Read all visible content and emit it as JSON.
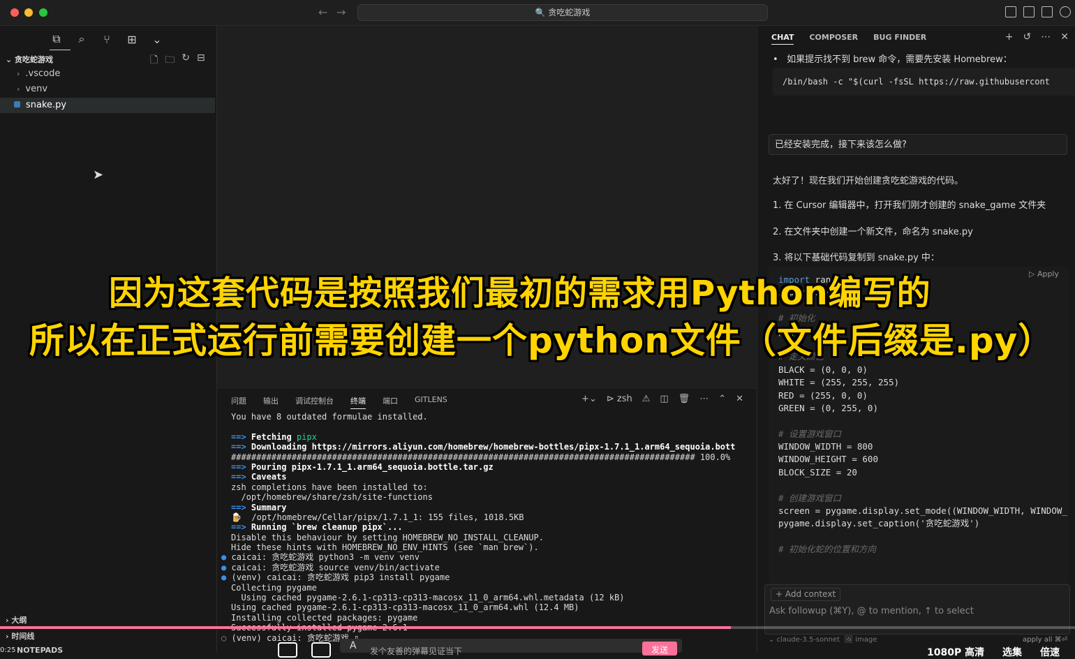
{
  "titlebar": {
    "search_title": "🔍 贪吃蛇游戏"
  },
  "sidebar": {
    "folder": "贪吃蛇游戏",
    "items": [
      ".vscode",
      "venv",
      "snake.py"
    ],
    "sections": [
      "大纲",
      "时间线",
      "NOTEPADS"
    ]
  },
  "panel": {
    "tabs": [
      "问题",
      "输出",
      "调试控制台",
      "终端",
      "端口",
      "GITLENS"
    ],
    "shell": "zsh",
    "terminal": [
      {
        "t": "plain",
        "text": "You have 8 outdated formulae installed."
      },
      {
        "t": "plain",
        "text": ""
      },
      {
        "t": "fetch",
        "prefix": "==>",
        "label": "Fetching",
        "rest": " pipx"
      },
      {
        "t": "arrow",
        "prefix": "==>",
        "text": "Downloading https://mirrors.aliyun.com/homebrew/homebrew-bottles/pipx-1.7.1_1.arm64_sequoia.bott"
      },
      {
        "t": "plain",
        "text": "############################################################################################ 100.0%"
      },
      {
        "t": "arrow",
        "prefix": "==>",
        "text": "Pouring pipx-1.7.1_1.arm64_sequoia.bottle.tar.gz"
      },
      {
        "t": "arrow",
        "prefix": "==>",
        "text": "Caveats"
      },
      {
        "t": "plain",
        "text": "zsh completions have been installed to:"
      },
      {
        "t": "plain",
        "text": "  /opt/homebrew/share/zsh/site-functions"
      },
      {
        "t": "arrow",
        "prefix": "==>",
        "text": "Summary"
      },
      {
        "t": "plain",
        "text": "🍺  /opt/homebrew/Cellar/pipx/1.7.1_1: 155 files, 1018.5KB"
      },
      {
        "t": "arrow",
        "prefix": "==>",
        "text": "Running `brew cleanup pipx`..."
      },
      {
        "t": "plain",
        "text": "Disable this behaviour by setting HOMEBREW_NO_INSTALL_CLEANUP."
      },
      {
        "t": "plain",
        "text": "Hide these hints with HOMEBREW_NO_ENV_HINTS (see `man brew`)."
      },
      {
        "t": "prompt",
        "text": "caicai: 贪吃蛇游戏 python3 -m venv venv"
      },
      {
        "t": "prompt",
        "text": "caicai: 贪吃蛇游戏 source venv/bin/activate"
      },
      {
        "t": "prompt",
        "text": "(venv) caicai: 贪吃蛇游戏 pip3 install pygame"
      },
      {
        "t": "plain",
        "text": "Collecting pygame"
      },
      {
        "t": "plain",
        "text": "  Using cached pygame-2.6.1-cp313-cp313-macosx_11_0_arm64.whl.metadata (12 kB)"
      },
      {
        "t": "plain",
        "text": "Using cached pygame-2.6.1-cp313-cp313-macosx_11_0_arm64.whl (12.4 MB)"
      },
      {
        "t": "plain",
        "text": "Installing collected packages: pygame"
      },
      {
        "t": "plain",
        "text": "Successfully installed pygame-2.6.1"
      },
      {
        "t": "prompt2",
        "text": "(venv) caicai: 贪吃蛇游戏 ▯"
      }
    ]
  },
  "chat": {
    "tabs": [
      "CHAT",
      "COMPOSER",
      "BUG FINDER"
    ],
    "bullet": "如果提示找不到 brew 命令，需要先安装 Homebrew：",
    "code1": "/bin/bash -c \"$(curl -fsSL https://raw.githubusercont",
    "user_msg": "已经安装完成，接下来该怎么做?",
    "reply_intro": "太好了！现在我们开始创建贪吃蛇游戏的代码。",
    "step1": "1. 在 Cursor 编辑器中，打开我们刚才创建的 snake_game 文件夹",
    "step2": "2. 在文件夹中创建一个新文件，命名为 snake.py",
    "step3": "3. 将以下基础代码复制到 snake.py 中：",
    "apply": "▷ Apply",
    "code_lines": [
      {
        "c": "kw",
        "text": "import random"
      },
      {
        "c": "plain",
        "text": "import sys"
      },
      {
        "c": "plain",
        "text": ""
      },
      {
        "c": "cm",
        "text": "# 初始化"
      },
      {
        "c": "fncall",
        "a": "pygame.",
        "b": "init",
        "d": "()"
      },
      {
        "c": "plain",
        "text": ""
      },
      {
        "c": "cm",
        "text": "# 定义颜色"
      },
      {
        "c": "plain",
        "text": "BLACK = (0, 0, 0)"
      },
      {
        "c": "plain",
        "text": "WHITE = (255, 255, 255)"
      },
      {
        "c": "plain",
        "text": "RED = (255, 0, 0)"
      },
      {
        "c": "plain",
        "text": "GREEN = (0, 255, 0)"
      },
      {
        "c": "plain",
        "text": ""
      },
      {
        "c": "cm",
        "text": "# 设置游戏窗口"
      },
      {
        "c": "plain",
        "text": "WINDOW_WIDTH = 800"
      },
      {
        "c": "plain",
        "text": "WINDOW_HEIGHT = 600"
      },
      {
        "c": "plain",
        "text": "BLOCK_SIZE = 20"
      },
      {
        "c": "plain",
        "text": ""
      },
      {
        "c": "cm",
        "text": "# 创建游戏窗口"
      },
      {
        "c": "plain",
        "text": "screen = pygame.display.set_mode((WINDOW_WIDTH, WINDOW_"
      },
      {
        "c": "plain",
        "text": "pygame.display.set_caption('贪吃蛇游戏')"
      },
      {
        "c": "plain",
        "text": ""
      },
      {
        "c": "cm",
        "text": "# 初始化蛇的位置和方向"
      }
    ],
    "add_context": "+ Add context",
    "ask_placeholder": "Ask followup (⌘Y), @ to mention, ↑ to select",
    "model": "claude-3.5-sonnet",
    "image_label": "image",
    "apply_all": "apply all ⌘⏎"
  },
  "overlay": {
    "caption1": "因为这套代码是按照我们最初的需求用Python编写的",
    "caption2": "所以在正式运行前需要创建一个python文件（文件后缀是.py）"
  },
  "player": {
    "progress": 0.68,
    "danmu_placeholder": "发个友善的弹幕见证当下",
    "send": "发送",
    "quality": "1080P 高清",
    "select": "选集",
    "speed": "倍速",
    "time": "0:25"
  },
  "colors": {
    "accent": "#fb7299",
    "caption": "#ffd400"
  }
}
